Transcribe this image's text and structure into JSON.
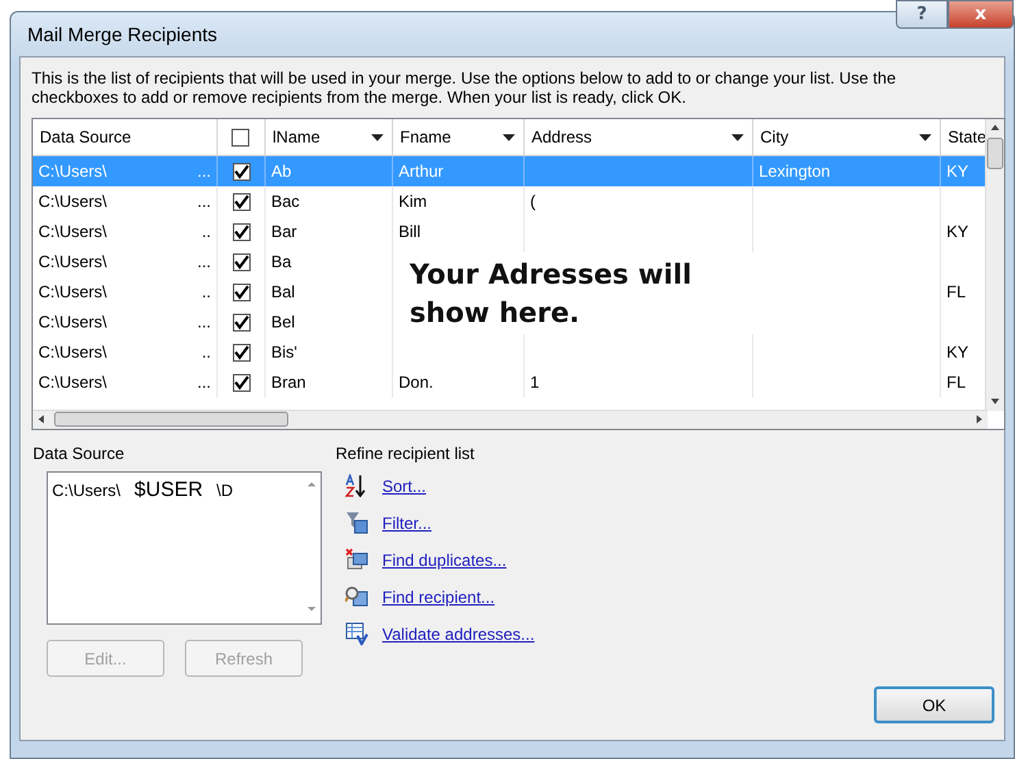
{
  "window": {
    "title": "Mail Merge Recipients",
    "buttons": [
      {
        "kind": "help",
        "label": "?"
      },
      {
        "kind": "close",
        "label": "x"
      }
    ]
  },
  "intro": "This is the list of recipients that will be used in your merge.  Use the options below to add to or change your list.  Use the checkboxes to add or remove recipients from the merge.  When your list is ready, click OK.",
  "table": {
    "columns": [
      {
        "kind": "text",
        "label": "Data Source",
        "dropdown": false
      },
      {
        "kind": "checkbox",
        "checked": false
      },
      {
        "kind": "text",
        "label": "lName",
        "dropdown": true
      },
      {
        "kind": "text",
        "label": "Fname",
        "dropdown": true
      },
      {
        "kind": "text",
        "label": "Address",
        "dropdown": true
      },
      {
        "kind": "text",
        "label": "City",
        "dropdown": true
      },
      {
        "kind": "text",
        "label": "State",
        "dropdown": false
      }
    ],
    "rows": [
      {
        "selected": true,
        "checked": true,
        "source": "C:\\Users\\",
        "source_more": "...",
        "lname": "Ab",
        "fname": "Arthur",
        "address": "",
        "city": "Lexington",
        "state": "KY"
      },
      {
        "selected": false,
        "checked": true,
        "source": "C:\\Users\\",
        "source_more": "...",
        "lname": "Bac",
        "fname": "Kim",
        "address": "(",
        "city": "",
        "state": ""
      },
      {
        "selected": false,
        "checked": true,
        "source": "C:\\Users\\",
        "source_more": "..",
        "lname": "Bar",
        "fname": "Bill",
        "address": "",
        "city": "",
        "state": "KY"
      },
      {
        "selected": false,
        "checked": true,
        "source": "C:\\Users\\",
        "source_more": "...",
        "lname": "Ba",
        "fname": "",
        "address": "",
        "city": "",
        "state": ""
      },
      {
        "selected": false,
        "checked": true,
        "source": "C:\\Users\\",
        "source_more": "..",
        "lname": "Bal",
        "fname": "",
        "address": "",
        "city": "",
        "state": "FL"
      },
      {
        "selected": false,
        "checked": true,
        "source": "C:\\Users\\",
        "source_more": "...",
        "lname": "Bel",
        "fname": "",
        "address": "",
        "city": "",
        "state": ""
      },
      {
        "selected": false,
        "checked": true,
        "source": "C:\\Users\\",
        "source_more": "..",
        "lname": "Bis'",
        "fname": "",
        "address": "",
        "city": "",
        "state": "KY"
      },
      {
        "selected": false,
        "checked": true,
        "source": "C:\\Users\\",
        "source_more": "...",
        "lname": "Bran",
        "fname": "Don.",
        "address": "1",
        "city": "",
        "state": "FL"
      }
    ],
    "overlay_note": "Your Adresses will show here."
  },
  "data_source": {
    "label": "Data Source",
    "entry": {
      "prefix": "C:\\Users\\",
      "user": "$USER",
      "suffix": "\\D"
    },
    "buttons": [
      {
        "label": "Edit...",
        "disabled": true
      },
      {
        "label": "Refresh",
        "disabled": true
      }
    ]
  },
  "refine": {
    "label": "Refine recipient list",
    "links": [
      {
        "kind": "sort",
        "label": "Sort..."
      },
      {
        "kind": "filter",
        "label": "Filter..."
      },
      {
        "kind": "duplicates",
        "label": "Find duplicates..."
      },
      {
        "kind": "find",
        "label": "Find recipient..."
      },
      {
        "kind": "validate",
        "label": "Validate addresses..."
      }
    ]
  },
  "ok_button": {
    "label": "OK",
    "default": true
  }
}
